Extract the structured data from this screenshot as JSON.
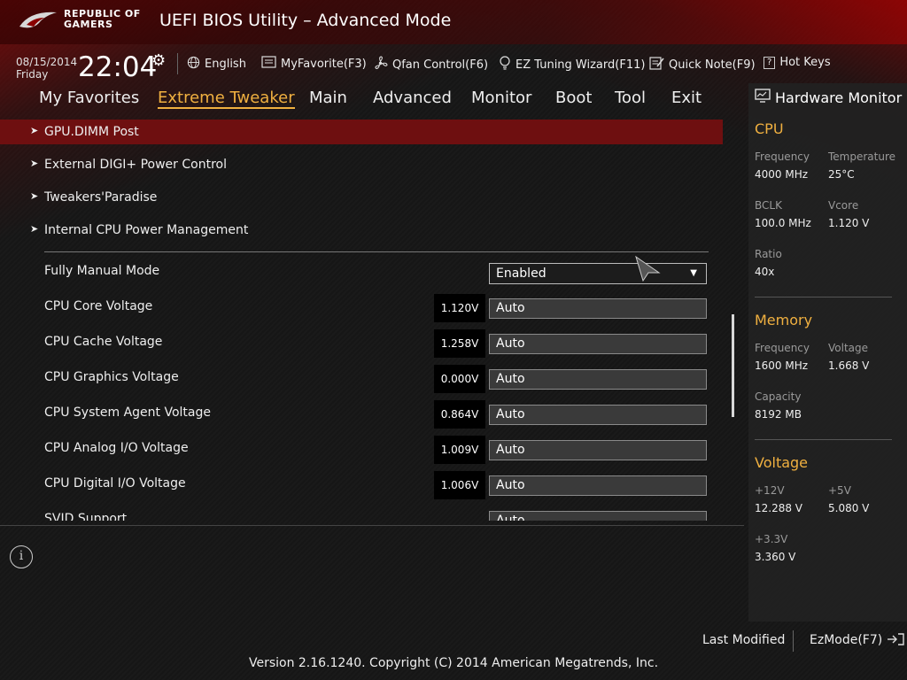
{
  "header": {
    "brand_line1": "REPUBLIC OF",
    "brand_line2": "GAMERS",
    "title": "UEFI BIOS Utility – Advanced Mode"
  },
  "info": {
    "date": "08/15/2014",
    "day": "Friday",
    "time": "22:04",
    "language": "English",
    "myfavorite": "MyFavorite(F3)",
    "qfan": "Qfan Control(F6)",
    "ez_tuning": "EZ Tuning Wizard(F11)",
    "quick_note": "Quick Note(F9)",
    "hot_keys": "Hot Keys"
  },
  "menu": {
    "tabs": [
      "My Favorites",
      "Extreme Tweaker",
      "Main",
      "Advanced",
      "Monitor",
      "Boot",
      "Tool",
      "Exit"
    ],
    "active": "Extreme Tweaker"
  },
  "submenus": [
    "GPU.DIMM Post",
    "External DIGI+ Power Control",
    "Tweakers'Paradise",
    "Internal CPU Power Management"
  ],
  "fully_manual": {
    "label": "Fully Manual Mode",
    "value": "Enabled"
  },
  "voltages": [
    {
      "label": "CPU Core Voltage",
      "current": "1.120V",
      "value": "Auto"
    },
    {
      "label": "CPU Cache Voltage",
      "current": "1.258V",
      "value": "Auto"
    },
    {
      "label": "CPU Graphics Voltage",
      "current": "0.000V",
      "value": "Auto"
    },
    {
      "label": "CPU System Agent Voltage",
      "current": "0.864V",
      "value": "Auto"
    },
    {
      "label": "CPU Analog I/O Voltage",
      "current": "1.009V",
      "value": "Auto"
    },
    {
      "label": "CPU Digital I/O Voltage",
      "current": "1.006V",
      "value": "Auto"
    },
    {
      "label": "SVID Support",
      "current": "",
      "value": "Auto"
    }
  ],
  "hwmon": {
    "title": "Hardware Monitor",
    "cpu": {
      "heading": "CPU",
      "freq_label": "Frequency",
      "freq": "4000 MHz",
      "temp_label": "Temperature",
      "temp": "25°C",
      "bclk_label": "BCLK",
      "bclk": "100.0 MHz",
      "vcore_label": "Vcore",
      "vcore": "1.120 V",
      "ratio_label": "Ratio",
      "ratio": "40x"
    },
    "memory": {
      "heading": "Memory",
      "freq_label": "Frequency",
      "freq": "1600 MHz",
      "volt_label": "Voltage",
      "volt": "1.668 V",
      "cap_label": "Capacity",
      "cap": "8192 MB"
    },
    "voltage": {
      "heading": "Voltage",
      "v12_label": "+12V",
      "v12": "12.288 V",
      "v5_label": "+5V",
      "v5": "5.080 V",
      "v33_label": "+3.3V",
      "v33": "3.360 V"
    }
  },
  "footer": {
    "last_modified": "Last Modified",
    "ezmode": "EzMode(F7)",
    "copyright": "Version 2.16.1240. Copyright (C) 2014 American Megatrends, Inc."
  },
  "colors": {
    "accent": "#f0b040",
    "selected_row": "#6e0f10"
  }
}
